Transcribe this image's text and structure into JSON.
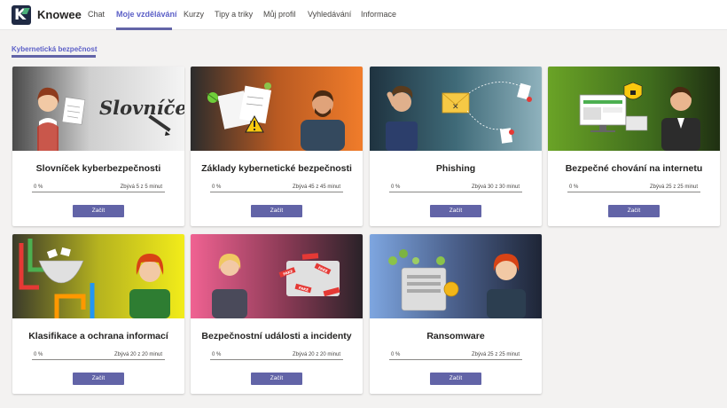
{
  "app": {
    "name": "Knowee"
  },
  "nav": {
    "items": [
      {
        "label": "Chat"
      },
      {
        "label": "Moje vzdělávání"
      },
      {
        "label": "Kurzy"
      },
      {
        "label": "Tipy a triky"
      },
      {
        "label": "Můj profil"
      },
      {
        "label": "Vyhledávání"
      },
      {
        "label": "Informace"
      }
    ],
    "active": "Moje vzdělávání"
  },
  "section": {
    "title": "Kybernetická bezpečnost"
  },
  "courses": [
    {
      "title": "Slovníček kyberbezpečnosti",
      "progress_label": "0 %",
      "progress": 0,
      "remaining": "Zbývá 5 z 5 minut",
      "button": "Začít"
    },
    {
      "title": "Základy kybernetické bezpečnosti",
      "progress_label": "0 %",
      "progress": 0,
      "remaining": "Zbývá 45 z 45 minut",
      "button": "Začít"
    },
    {
      "title": "Phishing",
      "progress_label": "0 %",
      "progress": 0,
      "remaining": "Zbývá 30 z 30 minut",
      "button": "Začít"
    },
    {
      "title": "Bezpečné chování na internetu",
      "progress_label": "0 %",
      "progress": 0,
      "remaining": "Zbývá 25 z 25 minut",
      "button": "Začít"
    },
    {
      "title": "Klasifikace a ochrana informací",
      "progress_label": "0 %",
      "progress": 0,
      "remaining": "Zbývá 20 z 20 minut",
      "button": "Začít"
    },
    {
      "title": "Bezpečnostní události a incidenty",
      "progress_label": "0 %",
      "progress": 0,
      "remaining": "Zbývá 20 z 20 minut",
      "button": "Začít"
    },
    {
      "title": "Ransomware",
      "progress_label": "0 %",
      "progress": 0,
      "remaining": "Zbývá 25 z 25 minut",
      "button": "Začít"
    }
  ],
  "illustrations": {
    "slovnicek_text": "Slovníček",
    "fake_tag": "FAKE"
  },
  "colors": {
    "accent": "#6264a7",
    "active_nav": "#5b5fc7"
  }
}
